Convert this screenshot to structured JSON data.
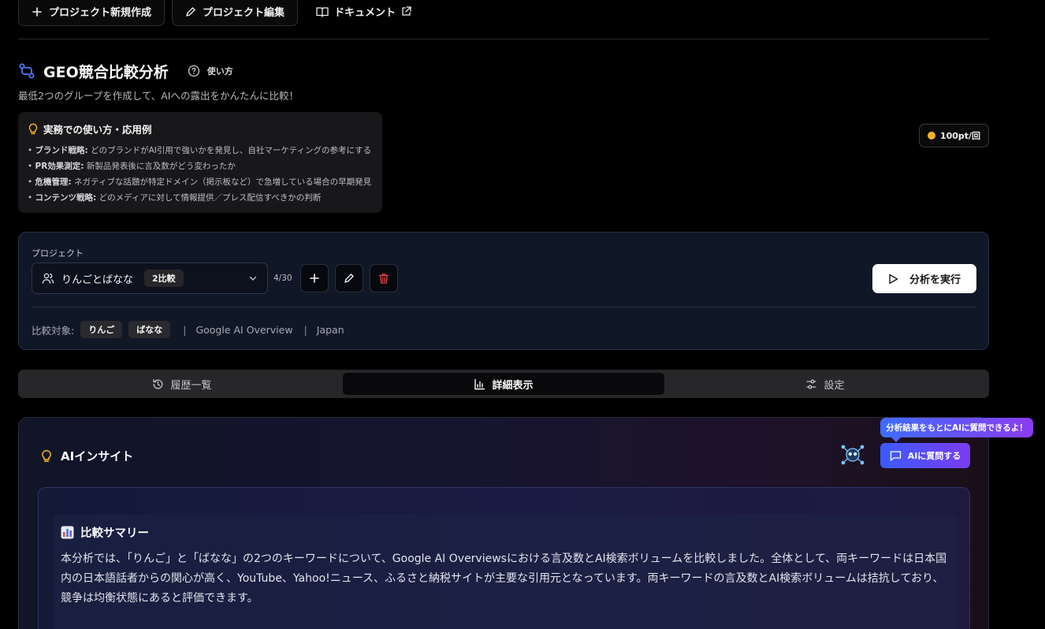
{
  "toolbar": {
    "new_project": "プロジェクト新規作成",
    "edit_project": "プロジェクト編集",
    "docs": "ドキュメント"
  },
  "header": {
    "title": "GEO競合比較分析",
    "help": "使い方",
    "subtitle": "最低2つのグループを作成して、AIへの露出をかんたんに比較！"
  },
  "tips": {
    "title": "実務での使い方・応用例",
    "items": [
      {
        "bold": "ブランド戦略:",
        "text": " どのブランドがAI引用で強いかを発見し、自社マーケティングの参考にする"
      },
      {
        "bold": "PR効果測定:",
        "text": " 新製品発表後に言及数がどう変わったか"
      },
      {
        "bold": "危機管理:",
        "text": " ネガティブな話題が特定ドメイン（掲示板など）で急増している場合の早期発見"
      },
      {
        "bold": "コンテンツ戦略:",
        "text": " どのメディアに対して情報提供／プレス配信すべきかの判断"
      }
    ]
  },
  "cost": {
    "label": "100pt/回",
    "color": "#f2b227"
  },
  "project": {
    "label": "プロジェクト",
    "selected": "りんごとばなな",
    "badge": "2比較",
    "count": "4/30",
    "run": "分析を実行",
    "compare_label": "比較対象:",
    "targets": [
      "りんご",
      "ばなな"
    ],
    "engine": "Google AI Overview",
    "region": "Japan"
  },
  "tabs": [
    {
      "label": "履歴一覧",
      "icon": "history-icon"
    },
    {
      "label": "詳細表示",
      "icon": "bar-chart-icon",
      "active": true
    },
    {
      "label": "設定",
      "icon": "sliders-icon"
    }
  ],
  "insight": {
    "title": "AIインサイト",
    "tooltip": "分析結果をもとにAIに質問できるよ！",
    "ask": "AIに質問する",
    "summary_title": "比較サマリー",
    "summary_body": "本分析では、「りんご」と「ばなな」の2つのキーワードについて、Google AI Overviewsにおける言及数とAI検索ボリュームを比較しました。全体として、両キーワードは日本国内の日本語話者からの関心が高く、YouTube、Yahoo!ニュース、ふるさと納税サイトが主要な引用元となっています。両キーワードの言及数とAI検索ボリュームは拮抗しており、競争は均衡状態にあると評価できます。"
  },
  "colors": {
    "accent_gradient_start": "#3b5bff",
    "accent_gradient_end": "#7a3cf0",
    "danger": "#ef4444",
    "title_icon": "#4f7cff"
  }
}
